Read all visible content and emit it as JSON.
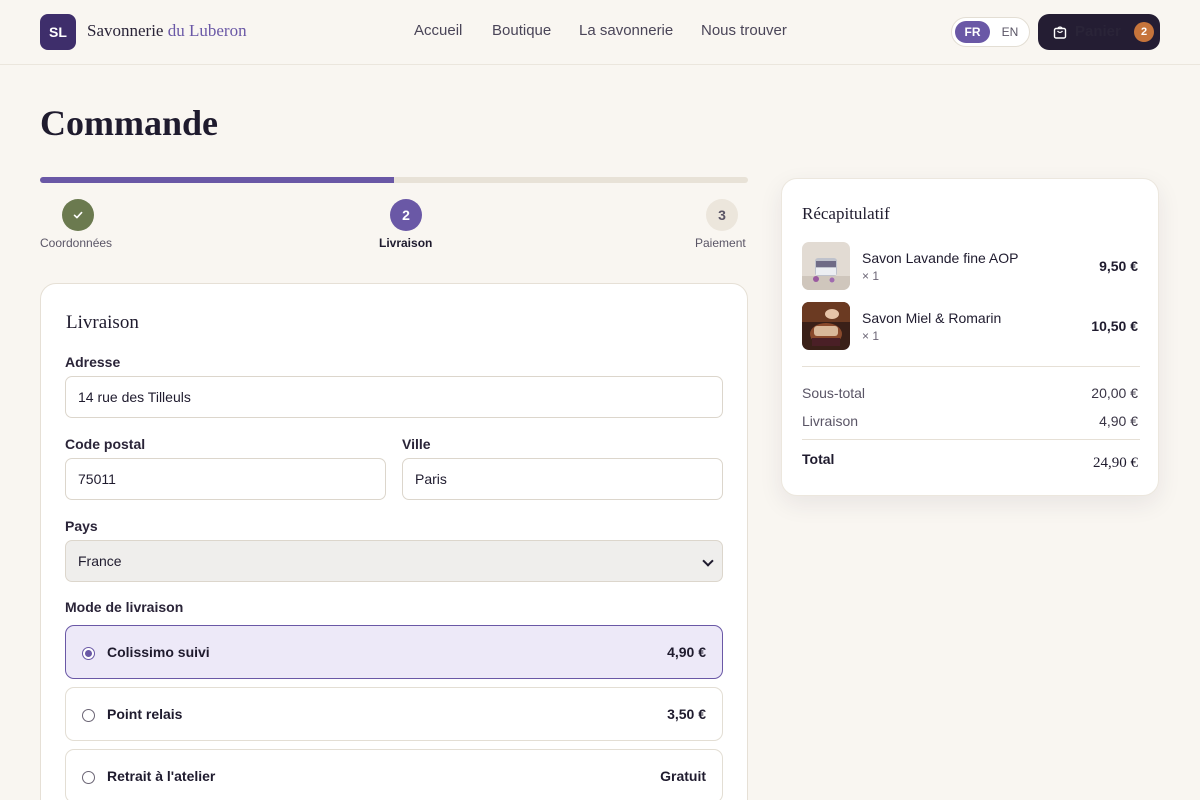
{
  "header": {
    "logo_initials": "SL",
    "brand_main": "Savonnerie",
    "brand_accent": "du Luberon",
    "nav": [
      "Accueil",
      "Boutique",
      "La savonnerie",
      "Nous trouver"
    ],
    "lang_active": "FR",
    "lang_other": "EN",
    "cart_label": "Panier",
    "cart_count": "2"
  },
  "page": {
    "title": "Commande"
  },
  "progress": {
    "fraction": 0.5
  },
  "steps": [
    {
      "number": "",
      "label": "Coordonnées",
      "state": "done"
    },
    {
      "number": "2",
      "label": "Livraison",
      "state": "active"
    },
    {
      "number": "3",
      "label": "Paiement",
      "state": "pending"
    }
  ],
  "form": {
    "title": "Livraison",
    "address_label": "Adresse",
    "address_value": "14 rue des Tilleuls",
    "postal_label": "Code postal",
    "postal_value": "75011",
    "city_label": "Ville",
    "city_value": "Paris",
    "country_label": "Pays",
    "country_value": "France",
    "delivery_label": "Mode de livraison",
    "delivery_options": [
      {
        "name": "Colissimo suivi",
        "price": "4,90 €",
        "selected": true
      },
      {
        "name": "Point relais",
        "price": "3,50 €",
        "selected": false
      },
      {
        "name": "Retrait à l'atelier",
        "price": "Gratuit",
        "selected": false
      }
    ]
  },
  "summary": {
    "title": "Récapitulatif",
    "items": [
      {
        "name": "Savon Lavande fine AOP",
        "qty": "× 1",
        "price": "9,50 €"
      },
      {
        "name": "Savon Miel & Romarin",
        "qty": "× 1",
        "price": "10,50 €"
      }
    ],
    "subtotal_label": "Sous-total",
    "subtotal_value": "20,00 €",
    "shipping_label": "Livraison",
    "shipping_value": "4,90 €",
    "total_label": "Total",
    "total_value": "24,90 €"
  },
  "colors": {
    "accent": "#6a58a6",
    "done_step": "#6b7a4f",
    "cart_badge": "#c6743b",
    "dark": "#241d33"
  }
}
